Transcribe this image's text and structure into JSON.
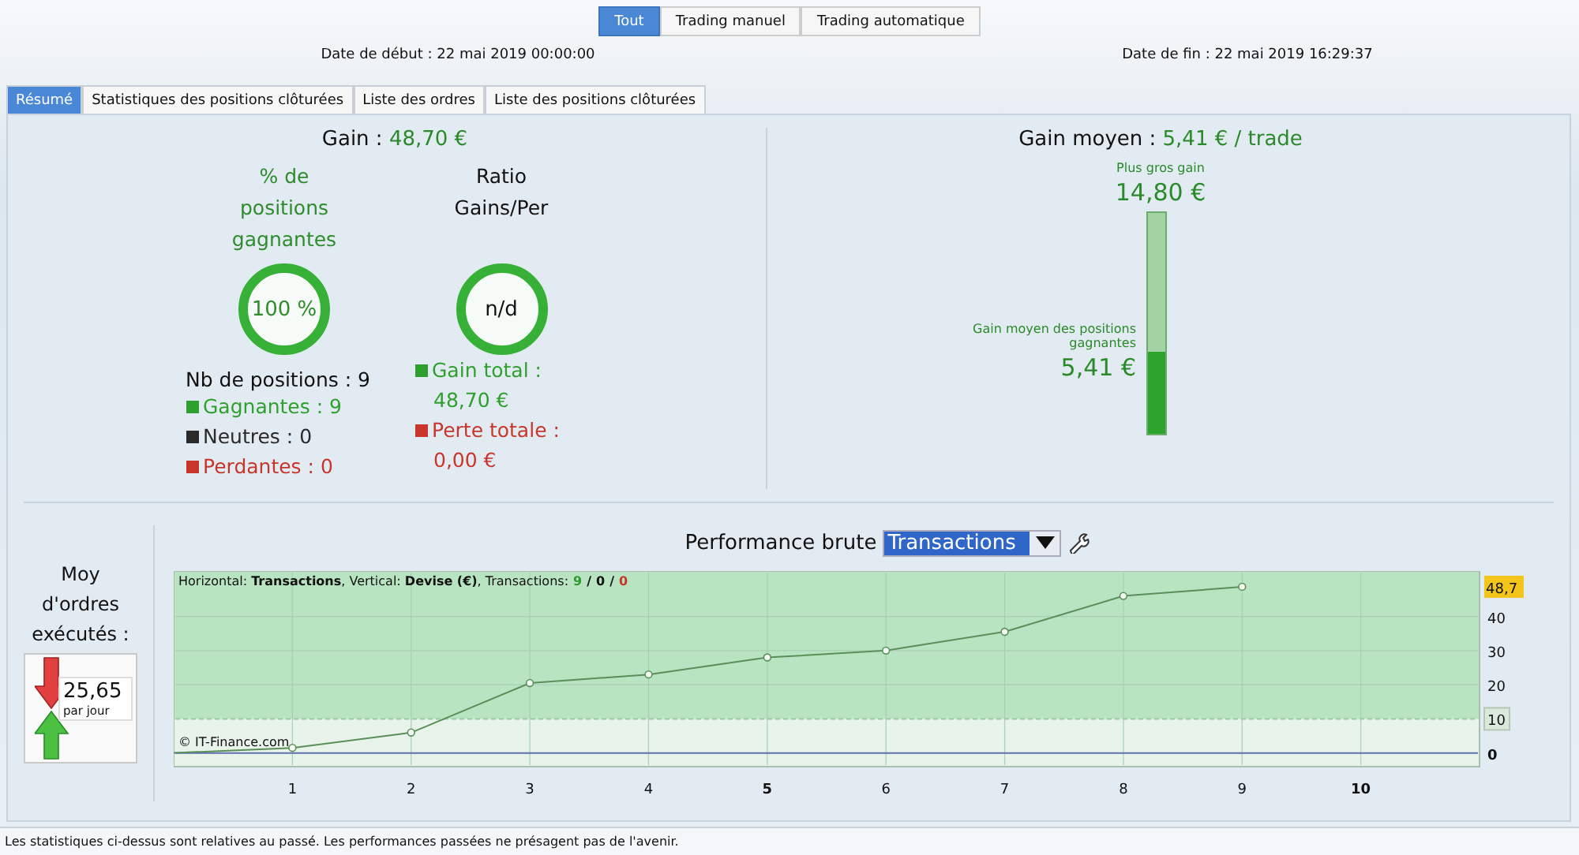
{
  "scope_buttons": [
    {
      "label": "Tout",
      "selected": true
    },
    {
      "label": "Trading manuel",
      "selected": false
    },
    {
      "label": "Trading automatique",
      "selected": false
    }
  ],
  "start_date": "Date de début : 22 mai 2019 00:00:00",
  "end_date": "Date de fin : 22 mai 2019 16:29:37",
  "tabs": [
    {
      "label": "Résumé",
      "selected": true
    },
    {
      "label": "Statistiques des positions clôturées",
      "selected": false
    },
    {
      "label": "Liste des ordres",
      "selected": false
    },
    {
      "label": "Liste des positions clôturées",
      "selected": false
    }
  ],
  "gain": {
    "label": "Gain :",
    "value": "48,70 €"
  },
  "gauges": [
    {
      "label": "% de positions gagnantes",
      "value": "100 %",
      "color": "#2e8b2e"
    },
    {
      "label": "Ratio Gains/Per",
      "value": "n/d",
      "color": "#111111"
    }
  ],
  "positions": {
    "title": "Nb de positions : 9",
    "items": [
      {
        "label": "Gagnantes : 9",
        "color": "#2ea02e"
      },
      {
        "label": "Neutres : 0",
        "color": "#2a2a2a"
      },
      {
        "label": "Perdantes : 0",
        "color": "#c8352a"
      }
    ]
  },
  "totals": [
    {
      "label": "Gain total :",
      "value": "48,70 €",
      "color": "#2ea02e"
    },
    {
      "label": "Perte totale :",
      "value": "0,00 €",
      "color": "#c8352a"
    }
  ],
  "average": {
    "label": "Gain moyen :",
    "value": "5,41 € / trade",
    "max_label": "Plus gros gain",
    "max_value": "14,80 €",
    "mean_label": "Gain moyen des positions gagnantes",
    "mean_value": "5,41 €",
    "level": 0.37
  },
  "orders": {
    "label": "Moy d'ordres exécutés :",
    "value": "25,65",
    "unit": "par jour"
  },
  "performance": {
    "mode": "Transactions",
    "legend": "Horizontal: **Transactions**, Vertical: **Devise (€)**, Transactions:",
    "counts": [
      {
        "text": "9",
        "color": "#2e9a2e"
      },
      {
        "text": "0",
        "color": "#111111"
      },
      {
        "text": "0",
        "color": "#c8352a"
      }
    ],
    "separator": "/",
    "credit": "© IT-Finance.com",
    "chart_data": {
      "type": "line",
      "title": "Performance brute",
      "x": [
        0,
        1,
        2,
        3,
        4,
        5,
        6,
        7,
        8,
        9
      ],
      "series": [
        {
          "color": "#5a8f5a",
          "marker": "circle",
          "values": [
            0,
            1.5,
            6,
            20.5,
            23,
            28,
            30,
            35.5,
            46,
            48.7
          ]
        }
      ],
      "xlim": [
        0,
        11
      ],
      "ylim": [
        -4,
        53.3
      ],
      "xticks": [
        1,
        2,
        3,
        4,
        5,
        6,
        7,
        8,
        9,
        10
      ],
      "yticks": [
        0,
        20,
        30,
        40
      ],
      "grid": true,
      "ref_lines": [
        {
          "axis": "y",
          "value": 10,
          "label": "10",
          "color": "#9cc9a6"
        },
        {
          "axis": "y",
          "value": 0,
          "color": "#6070b0"
        }
      ],
      "bands": [
        {
          "axis": "y",
          "from": 10,
          "to": 53.3,
          "color": "#b9e4c2"
        }
      ],
      "annotations": [
        "48,7"
      ]
    }
  },
  "disclaimer": "Les statistiques ci-dessus sont relatives au passé. Les performances passées ne présagent pas de l'avenir."
}
